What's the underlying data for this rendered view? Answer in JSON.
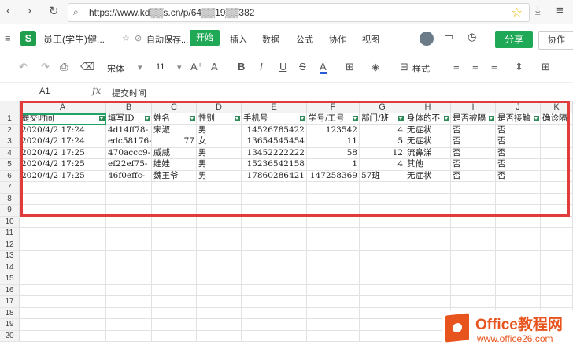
{
  "browser": {
    "url": "https://www.kd▒▒s.cn/p/64▒▒19▒▒382"
  },
  "app": {
    "logo_letter": "S",
    "doc_title": "员工(学生)健...",
    "autosave": "自动保存...",
    "menu": [
      "开始",
      "插入",
      "数据",
      "公式",
      "协作",
      "视图"
    ],
    "share_label": "分享",
    "collab_label": "协作"
  },
  "toolbar": {
    "font_name": "宋体",
    "font_size": "11",
    "style_label": "样式"
  },
  "formula_bar": {
    "cell_ref": "A1",
    "fx": "fx",
    "value": "提交时间"
  },
  "sheet": {
    "columns": [
      "A",
      "B",
      "C",
      "D",
      "E",
      "F",
      "G",
      "H",
      "I",
      "J",
      "K"
    ],
    "headers": [
      "提交时间",
      "填写ID",
      "姓名",
      "性别",
      "手机号",
      "学号/工号",
      "部门/班",
      "身体的不",
      "是否被隔",
      "是否接触",
      "确诊隔"
    ],
    "rows": [
      [
        "2020/4/2  17:24",
        "4d14ff78-",
        "宋淑",
        "男",
        "14526785422",
        "123542",
        "4",
        "无症状",
        "否",
        "否",
        ""
      ],
      [
        "2020/4/2  17:24",
        "edc58176-",
        "77",
        "女",
        "13654545454",
        "11",
        "5",
        "无症状",
        "否",
        "否",
        ""
      ],
      [
        "2020/4/2  17:25",
        "470accc9-",
        "威威",
        "男",
        "13452222222",
        "58",
        "12",
        "流鼻涕",
        "否",
        "否",
        ""
      ],
      [
        "2020/4/2  17:25",
        "ef22ef75-",
        "娃娃",
        "男",
        "15236542158",
        "1",
        "4",
        "其他",
        "否",
        "否",
        ""
      ],
      [
        "2020/4/2  17:25",
        "46f0effc-",
        "魏王爷",
        "男",
        "17860286421",
        "147258369",
        "57班",
        "无症状",
        "否",
        "否",
        ""
      ]
    ],
    "row_numbers": [
      "1",
      "2",
      "3",
      "4",
      "5",
      "6",
      "7",
      "8",
      "9",
      "10",
      "11",
      "12",
      "13",
      "14",
      "15",
      "16",
      "17",
      "18",
      "19",
      "20"
    ]
  },
  "watermark": {
    "brand": "Office教程网",
    "url": "www.office26.com"
  },
  "colors": {
    "accent_green": "#1fa855",
    "highlight_red": "#e23b3b",
    "brand_orange": "#e8541e"
  }
}
